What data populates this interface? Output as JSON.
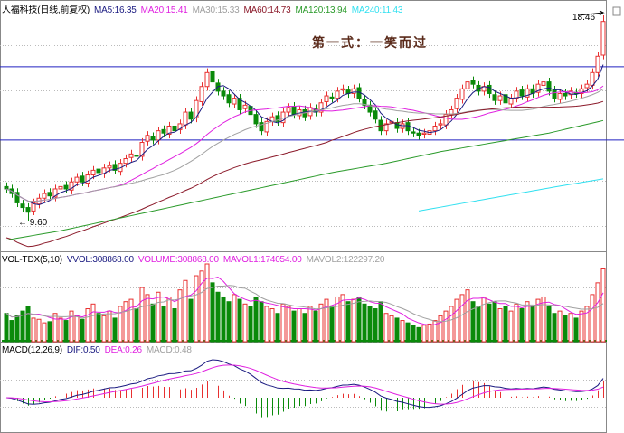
{
  "header": {
    "name": "人福科技(日线,前复权)",
    "ma5": "MA5:16.35",
    "ma20": "MA20:15.41",
    "ma30": "MA30:15.33",
    "ma60": "MA60:14.73",
    "ma120": "MA120:13.94",
    "ma240": "MA240:11.43"
  },
  "vol_header": {
    "name": "VOL-TDX(5,10)",
    "vvol": "VVOL:308868.00",
    "volume": "VOLUME:308868.00",
    "mavol1": "MAVOL1:174054.00",
    "mavol2": "MAVOL2:122297.20"
  },
  "macd_header": {
    "name": "MACD(12,26,9)",
    "dif": "DIF:0.50",
    "dea": "DEA:0.26",
    "macd": "MACD:0.48"
  },
  "annotation": "第一式：一笑而过",
  "high_label": "18.46",
  "low_label": "9.60",
  "colors": {
    "up": "#e83030",
    "down": "#0a8a0a",
    "ma5": "#1a1a80",
    "ma20": "#e020e0",
    "ma30": "#a0a0a0",
    "ma60": "#8b1a2a",
    "ma120": "#2a9a2a",
    "ma240": "#30e0f0",
    "hline": "#2020c0"
  },
  "chart_data": {
    "type": "candlestick",
    "price_range": [
      8.5,
      18.7
    ],
    "high": 18.46,
    "low": 9.6,
    "hlines": [
      16.25,
      13.1
    ],
    "close": [
      11.0,
      10.8,
      10.4,
      10.2,
      10.0,
      10.4,
      10.6,
      10.8,
      10.7,
      11.0,
      11.1,
      11.0,
      11.3,
      11.5,
      11.3,
      11.6,
      11.8,
      11.7,
      11.9,
      12.0,
      11.8,
      12.1,
      12.3,
      12.5,
      12.4,
      13.0,
      13.3,
      13.1,
      13.5,
      13.4,
      13.7,
      13.5,
      13.8,
      14.3,
      14.0,
      14.8,
      15.4,
      16.0,
      15.6,
      15.2,
      15.0,
      14.7,
      14.9,
      14.4,
      14.6,
      14.2,
      13.8,
      13.5,
      13.9,
      14.1,
      13.9,
      14.3,
      14.5,
      14.2,
      14.4,
      14.1,
      14.5,
      14.3,
      14.7,
      15.0,
      14.9,
      15.2,
      15.3,
      15.1,
      15.3,
      14.9,
      14.6,
      14.3,
      14.0,
      13.5,
      13.8,
      13.9,
      13.6,
      13.8,
      13.5,
      13.4,
      13.3,
      13.4,
      13.5,
      13.7,
      13.8,
      14.2,
      14.4,
      14.9,
      15.3,
      15.6,
      15.5,
      15.2,
      15.4,
      15.1,
      14.8,
      15.0,
      14.7,
      14.9,
      15.2,
      15.0,
      15.3,
      15.1,
      15.5,
      15.6,
      15.2,
      14.9,
      15.1,
      15.0,
      15.2,
      15.1,
      15.3,
      15.5,
      16.0,
      16.7,
      18.2
    ],
    "volume": [
      120000,
      90000,
      110000,
      130000,
      150000,
      100000,
      95000,
      80000,
      85000,
      120000,
      100000,
      90000,
      130000,
      110000,
      95000,
      140000,
      160000,
      120000,
      110000,
      130000,
      100000,
      150000,
      170000,
      180000,
      140000,
      230000,
      200000,
      160000,
      210000,
      150000,
      190000,
      140000,
      220000,
      260000,
      180000,
      280000,
      300000,
      330000,
      250000,
      210000,
      190000,
      170000,
      200000,
      180000,
      160000,
      150000,
      190000,
      170000,
      150000,
      140000,
      120000,
      160000,
      150000,
      130000,
      140000,
      120000,
      150000,
      130000,
      160000,
      180000,
      150000,
      190000,
      200000,
      170000,
      180000,
      190000,
      160000,
      150000,
      140000,
      170000,
      120000,
      110000,
      100000,
      90000,
      80000,
      70000,
      60000,
      70000,
      75000,
      90000,
      110000,
      130000,
      150000,
      180000,
      200000,
      220000,
      170000,
      150000,
      190000,
      160000,
      170000,
      140000,
      150000,
      130000,
      160000,
      140000,
      170000,
      150000,
      180000,
      190000,
      150000,
      120000,
      130000,
      110000,
      120000,
      100000,
      130000,
      150000,
      200000,
      250000,
      308868
    ],
    "ma120_samples": [
      8.8,
      9.2,
      9.7,
      10.2,
      10.7,
      11.2,
      11.7,
      12.1,
      12.6,
      13.0,
      13.4,
      13.94
    ],
    "ma240_start_index": 76,
    "ma240_samples": [
      10.05,
      10.4,
      10.75,
      11.1,
      11.43
    ]
  }
}
